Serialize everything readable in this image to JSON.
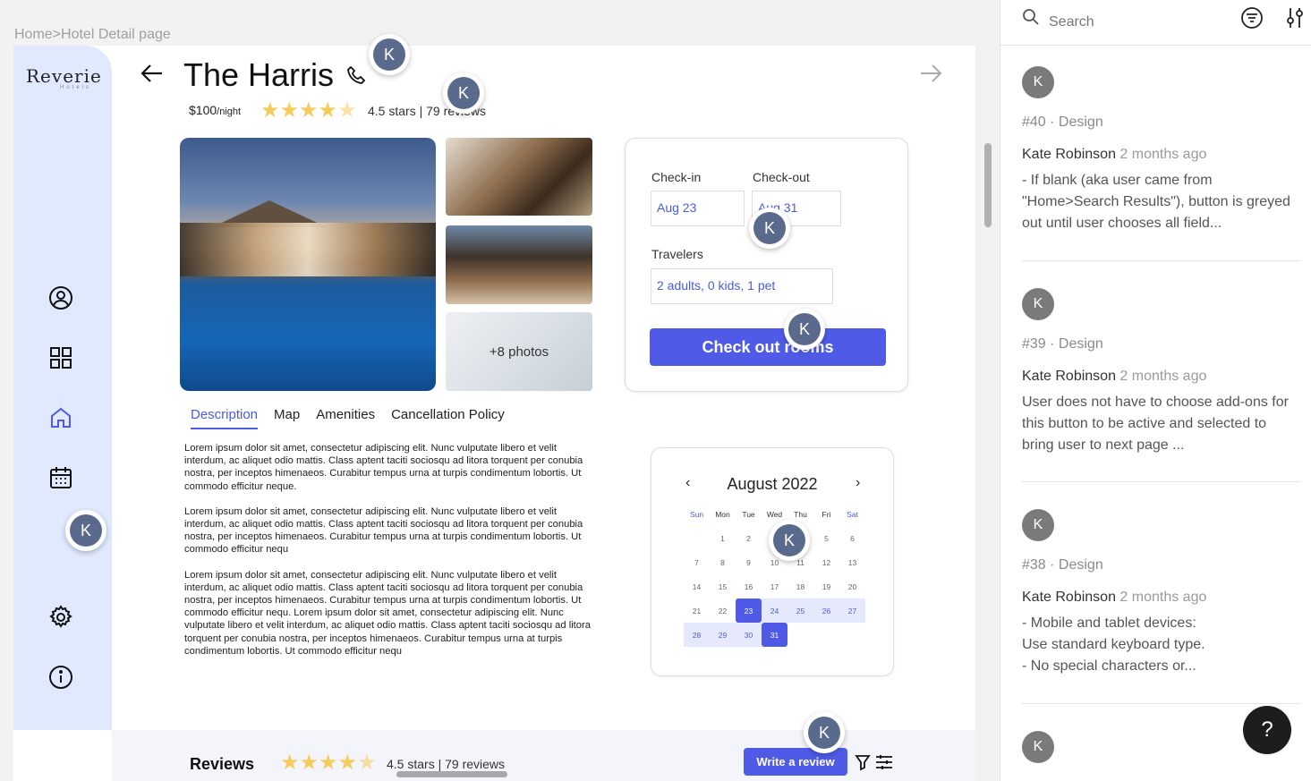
{
  "breadcrumb": "Home>Hotel Detail page",
  "logo": {
    "name": "Reverie",
    "sub": "Hotels"
  },
  "hotel": {
    "name": "The Harris",
    "price": "$100",
    "price_unit": "/night",
    "rating_text": "4.5 stars | 79 reviews",
    "rating": 4.5,
    "more_photos": "+8 photos"
  },
  "tabs": [
    "Description",
    "Map",
    "Amenities",
    "Cancellation Policy"
  ],
  "description": [
    "Lorem ipsum dolor sit amet, consectetur adipiscing elit. Nunc vulputate libero et velit interdum, ac aliquet odio mattis. Class aptent taciti sociosqu ad litora torquent per conubia nostra, per inceptos himenaeos. Curabitur tempus urna at turpis condimentum lobortis. Ut commodo efficitur neque.",
    "Lorem ipsum dolor sit amet, consectetur adipiscing elit. Nunc vulputate libero et velit interdum, ac aliquet odio mattis. Class aptent taciti sociosqu ad litora torquent per conubia nostra, per inceptos himenaeos. Curabitur tempus urna at turpis condimentum lobortis. Ut commodo efficitur nequ",
    "Lorem ipsum dolor sit amet, consectetur adipiscing elit. Nunc vulputate libero et velit interdum, ac aliquet odio mattis. Class aptent taciti sociosqu ad litora torquent per conubia nostra, per inceptos himenaeos. Curabitur tempus urna at turpis condimentum lobortis. Ut commodo efficitur nequ. Lorem ipsum dolor sit amet, consectetur adipiscing elit. Nunc vulputate libero et velit interdum, ac aliquet odio mattis. Class aptent taciti sociosqu ad litora torquent per conubia nostra, per inceptos himenaeos. Curabitur tempus urna at turpis condimentum lobortis. Ut commodo efficitur nequ"
  ],
  "booking": {
    "checkin_label": "Check-in",
    "checkout_label": "Check-out",
    "checkin_value": "Aug 23",
    "checkout_value": "Aug 31",
    "travelers_label": "Travelers",
    "travelers_value": "2 adults, 0 kids, 1 pet",
    "button_label": "Check out rooms"
  },
  "calendar": {
    "title": "August 2022",
    "weekdays": [
      "Sun",
      "Mon",
      "Tue",
      "Wed",
      "Thu",
      "Fri",
      "Sat"
    ],
    "weeks": [
      [
        "",
        "1",
        "2",
        "3",
        "4",
        "5",
        "6"
      ],
      [
        "7",
        "8",
        "9",
        "10",
        "11",
        "12",
        "13"
      ],
      [
        "14",
        "15",
        "16",
        "17",
        "18",
        "19",
        "20"
      ],
      [
        "21",
        "22",
        "23",
        "24",
        "25",
        "26",
        "27"
      ],
      [
        "28",
        "29",
        "30",
        "31",
        "",
        "",
        ""
      ]
    ],
    "range_start": 23,
    "range_end": 31
  },
  "reviews": {
    "title": "Reviews",
    "rating_text": "4.5 stars | 79 reviews",
    "write_button": "Write a review"
  },
  "avatar_initial": "K",
  "panel": {
    "search_placeholder": "Search",
    "comments": [
      {
        "meta": "#40 · Design",
        "author": "Kate Robinson",
        "time": "2 months ago",
        "text": "- If blank (aka user came from \"Home>Search Results\"), button is greyed out until user chooses all field..."
      },
      {
        "meta": "#39 · Design",
        "author": "Kate Robinson",
        "time": "2 months ago",
        "text": "User does not have to choose add-ons for this button to be active and selected to bring user to next page ..."
      },
      {
        "meta": "#38 · Design",
        "author": "Kate Robinson",
        "time": "2 months ago",
        "text": "- Mobile and tablet devices:\nUse standard keyboard type.\n- No special characters or..."
      }
    ],
    "help_label": "?"
  },
  "colors": {
    "accent": "#4f5be6",
    "sidebar": "#e0e9fd",
    "star": "#f5cb5c"
  }
}
